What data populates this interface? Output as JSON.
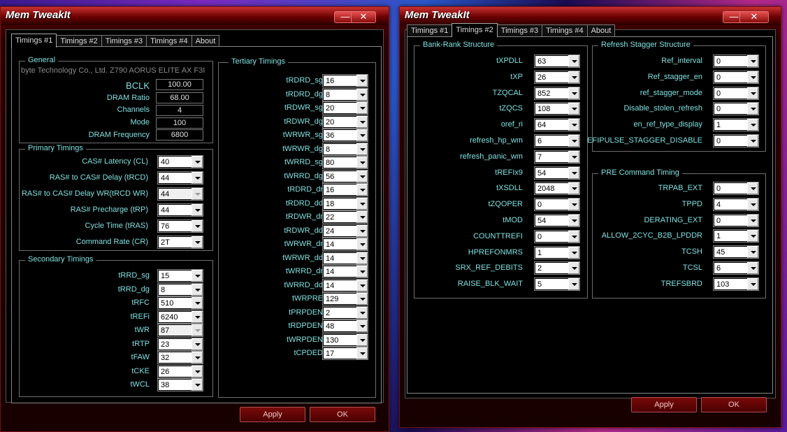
{
  "window1": {
    "title": "Mem TweakIt",
    "minimize": "—",
    "close": "✕",
    "tabs": [
      "Timings #1",
      "Timings #2",
      "Timings #3",
      "Timings #4",
      "About"
    ],
    "general": {
      "title": "General",
      "board": "byte Technology Co., Ltd. Z790 AORUS ELITE AX F3I",
      "rows": [
        {
          "label": "BCLK",
          "value": "100.00"
        },
        {
          "label": "DRAM Ratio",
          "value": "68.00"
        },
        {
          "label": "Channels",
          "value": "4"
        },
        {
          "label": "Mode",
          "value": "100"
        },
        {
          "label": "DRAM Frequency",
          "value": "6800"
        }
      ]
    },
    "primary": {
      "title": "Primary Timings",
      "rows": [
        {
          "label": "CAS# Latency (CL)",
          "value": "40"
        },
        {
          "label": "RAS# to CAS# Delay (tRCD)",
          "value": "44"
        },
        {
          "label": "RAS# to CAS# Delay WR(tRCD WR)",
          "value": "44"
        },
        {
          "label": "RAS# Precharge (tRP)",
          "value": "44"
        },
        {
          "label": "Cycle Time (tRAS)",
          "value": "76"
        },
        {
          "label": "Command Rate (CR)",
          "value": "2T"
        }
      ]
    },
    "secondary": {
      "title": "Secondary Timings",
      "rows": [
        {
          "label": "tRRD_sg",
          "value": "15"
        },
        {
          "label": "tRRD_dg",
          "value": "8"
        },
        {
          "label": "tRFC",
          "value": "510"
        },
        {
          "label": "tREFi",
          "value": "6240"
        },
        {
          "label": "tWR",
          "value": "87"
        },
        {
          "label": "tRTP",
          "value": "23"
        },
        {
          "label": "tFAW",
          "value": "32"
        },
        {
          "label": "tCKE",
          "value": "26"
        },
        {
          "label": "tWCL",
          "value": "38"
        }
      ]
    },
    "tertiary": {
      "title": "Tertiary Timings",
      "rows": [
        {
          "label": "tRDRD_sg",
          "value": "16"
        },
        {
          "label": "tRDRD_dg",
          "value": "8"
        },
        {
          "label": "tRDWR_sg",
          "value": "20"
        },
        {
          "label": "tRDWR_dg",
          "value": "20"
        },
        {
          "label": "tWRWR_sg",
          "value": "36"
        },
        {
          "label": "tWRWR_dg",
          "value": "8"
        },
        {
          "label": "tWRRD_sg",
          "value": "80"
        },
        {
          "label": "tWRRD_dg",
          "value": "56"
        },
        {
          "label": "tRDRD_dr",
          "value": "16"
        },
        {
          "label": "tRDRD_dd",
          "value": "18"
        },
        {
          "label": "tRDWR_dr",
          "value": "22"
        },
        {
          "label": "tRDWR_dd",
          "value": "24"
        },
        {
          "label": "tWRWR_dr",
          "value": "14"
        },
        {
          "label": "tWRWR_dd",
          "value": "14"
        },
        {
          "label": "tWRRD_dr",
          "value": "14"
        },
        {
          "label": "tWRRD_dd",
          "value": "14"
        },
        {
          "label": "tWRPRE",
          "value": "129"
        },
        {
          "label": "tPRPDEN",
          "value": "2"
        },
        {
          "label": "tRDPDEN",
          "value": "48"
        },
        {
          "label": "tWRPDEN",
          "value": "130"
        },
        {
          "label": "tCPDED",
          "value": "17"
        }
      ]
    },
    "apply": "Apply",
    "ok": "OK"
  },
  "window2": {
    "title": "Mem TweakIt",
    "minimize": "—",
    "close": "✕",
    "tabs": [
      "Timings #1",
      "Timings #2",
      "Timings #3",
      "Timings #4",
      "About"
    ],
    "bankrank": {
      "title": "Bank-Rank Structure",
      "rows": [
        {
          "label": "tXPDLL",
          "value": "63"
        },
        {
          "label": "tXP",
          "value": "26"
        },
        {
          "label": "TZQCAL",
          "value": "852"
        },
        {
          "label": "tZQCS",
          "value": "108"
        },
        {
          "label": "oref_ri",
          "value": "64"
        },
        {
          "label": "refresh_hp_wm",
          "value": "6"
        },
        {
          "label": "refresh_panic_wm",
          "value": "7"
        },
        {
          "label": "tREFIx9",
          "value": "54"
        },
        {
          "label": "tXSDLL",
          "value": "2048"
        },
        {
          "label": "tZQOPER",
          "value": "0"
        },
        {
          "label": "tMOD",
          "value": "54"
        },
        {
          "label": "COUNTTREFI",
          "value": "0"
        },
        {
          "label": "HPREFONMRS",
          "value": "1"
        },
        {
          "label": "SRX_REF_DEBITS",
          "value": "2"
        },
        {
          "label": "RAISE_BLK_WAIT",
          "value": "5"
        }
      ]
    },
    "refresh": {
      "title": "Refresh Stagger Structure",
      "rows": [
        {
          "label": "Ref_interval",
          "value": "0"
        },
        {
          "label": "Ref_stagger_en",
          "value": "0"
        },
        {
          "label": "ref_stagger_mode",
          "value": "0"
        },
        {
          "label": "Disable_stolen_refresh",
          "value": "0"
        },
        {
          "label": "en_ref_type_display",
          "value": "1"
        },
        {
          "label": "EFIPULSE_STAGGER_DISABLE",
          "value": "0"
        }
      ]
    },
    "pre": {
      "title": "PRE Command Timing",
      "rows": [
        {
          "label": "TRPAB_EXT",
          "value": "0"
        },
        {
          "label": "TPPD",
          "value": "4"
        },
        {
          "label": "DERATING_EXT",
          "value": "0"
        },
        {
          "label": "ALLOW_2CYC_B2B_LPDDR",
          "value": "1"
        },
        {
          "label": "TCSH",
          "value": "45"
        },
        {
          "label": "TCSL",
          "value": "6"
        },
        {
          "label": "TREFSBRD",
          "value": "103"
        }
      ]
    },
    "apply": "Apply",
    "ok": "OK"
  }
}
